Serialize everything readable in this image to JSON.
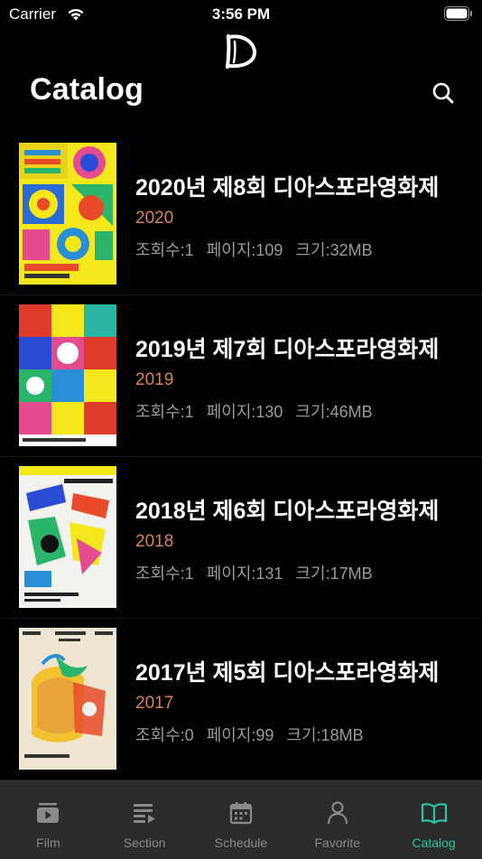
{
  "status_bar": {
    "carrier": "Carrier",
    "time": "3:56 PM"
  },
  "header": {
    "title": "Catalog"
  },
  "catalog": [
    {
      "title": "2020년 제8회 디아스포라영화제",
      "year": "2020",
      "views": "조회수:1",
      "pages": "페이지:109",
      "size": "크기:32MB"
    },
    {
      "title": "2019년 제7회 디아스포라영화제",
      "year": "2019",
      "views": "조회수:1",
      "pages": "페이지:130",
      "size": "크기:46MB"
    },
    {
      "title": "2018년 제6회 디아스포라영화제",
      "year": "2018",
      "views": "조회수:1",
      "pages": "페이지:131",
      "size": "크기:17MB"
    },
    {
      "title": "2017년 제5회 디아스포라영화제",
      "year": "2017",
      "views": "조회수:0",
      "pages": "페이지:99",
      "size": "크기:18MB"
    }
  ],
  "tabbar": {
    "tabs": [
      {
        "label": "Film",
        "icon": "film-icon"
      },
      {
        "label": "Section",
        "icon": "section-list-icon"
      },
      {
        "label": "Schedule",
        "icon": "calendar-icon"
      },
      {
        "label": "Favorite",
        "icon": "person-icon"
      },
      {
        "label": "Catalog",
        "icon": "book-icon"
      }
    ],
    "active": "Catalog",
    "active_color": "#2fc2a2"
  },
  "colors": {
    "year": "#d9825a",
    "meta": "#9a9a9a",
    "tabbar_bg": "#2b2b2b"
  }
}
